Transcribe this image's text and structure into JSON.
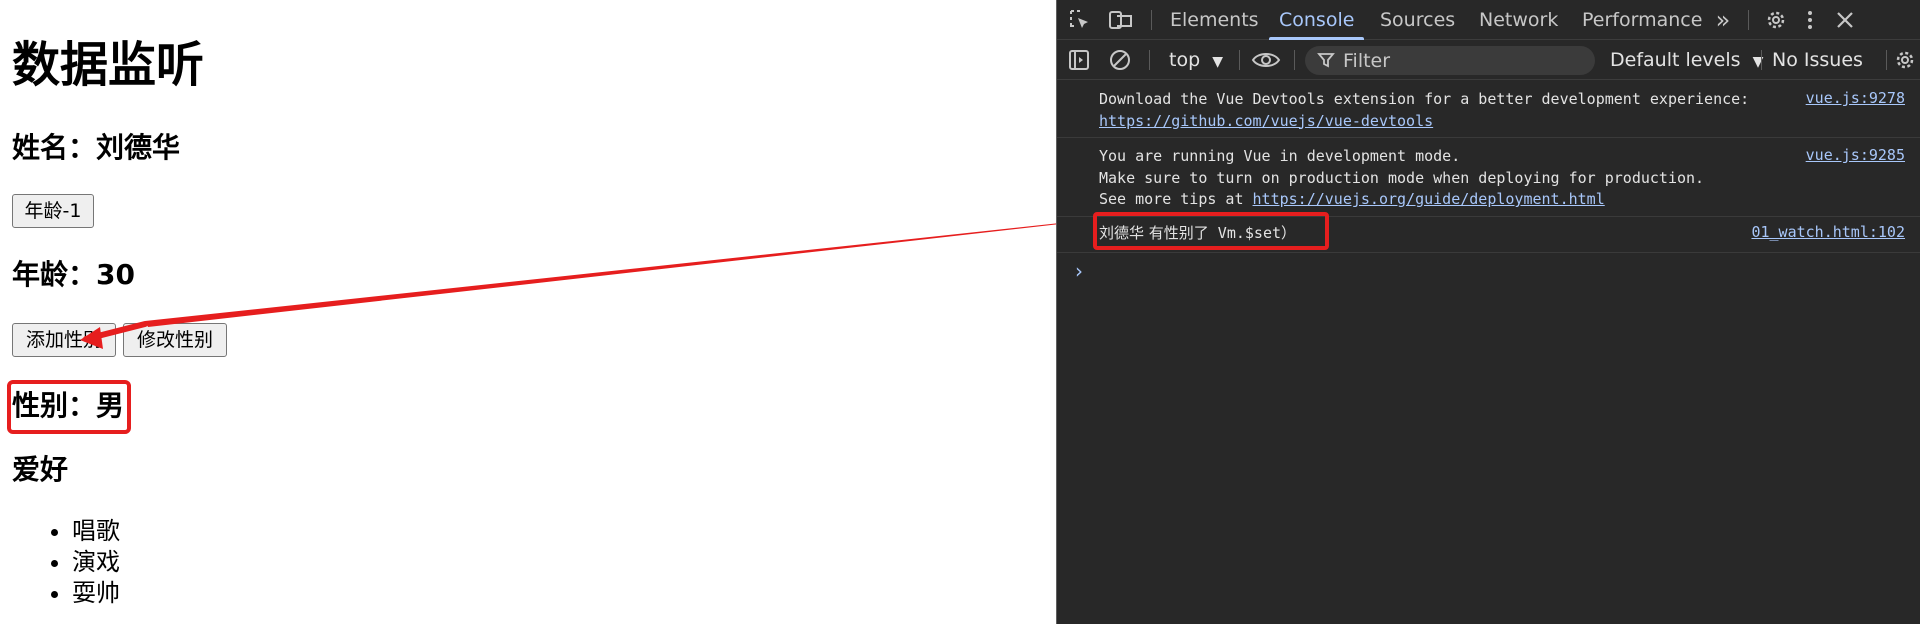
{
  "page": {
    "title": "数据监听",
    "name_line": "姓名：刘德华",
    "age_button": "年龄-1",
    "age_line": "年龄：30",
    "add_gender_button": "添加性别",
    "edit_gender_button": "修改性别",
    "gender_line": "性别：男",
    "hobby_title": "爱好",
    "hobbies": [
      "唱歌",
      "演戏",
      "耍帅"
    ]
  },
  "devtools": {
    "tabs": [
      "Elements",
      "Console",
      "Sources",
      "Network",
      "Performance"
    ],
    "active_tab": "Console",
    "more_tabs_icon": "chevron-double-right",
    "context": "top",
    "filter_placeholder": "Filter",
    "levels": "Default levels",
    "issues": "No Issues",
    "messages": [
      {
        "line1": "Download the Vue Devtools extension for a better development experience:",
        "link": "https://github.com/vuejs/vue-devtools",
        "source": "vue.js:9278"
      },
      {
        "line1": "You are running Vue in development mode.",
        "line2": "Make sure to turn on production mode when deploying for production.",
        "line3_prefix": "See more tips at ",
        "line3_link": "https://vuejs.org/guide/deployment.html",
        "source": "vue.js:9285"
      },
      {
        "cjk": "刘德华 有性别了",
        "mono": " Vm.$set）",
        "source": "01_watch.html:102"
      }
    ]
  },
  "colors": {
    "annotation_red": "#e61e1e",
    "devtools_bg": "#282828",
    "accent_blue": "#a8c7fa"
  }
}
